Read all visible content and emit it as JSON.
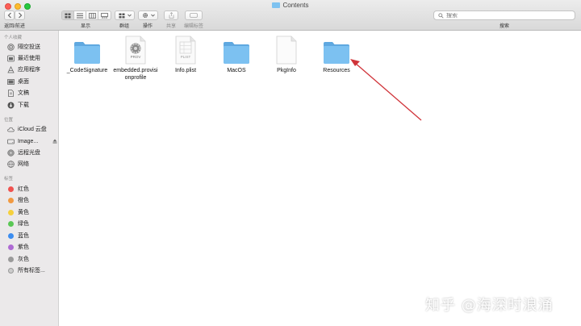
{
  "window": {
    "title": "Contents"
  },
  "toolbar": {
    "back_forward_label": "返回/前进",
    "view_label": "显示",
    "group_label": "群组",
    "action_label": "操作",
    "share_label": "共享",
    "edit_tags_label": "编辑标签",
    "search_placeholder": "搜索",
    "search_label": "搜索"
  },
  "sidebar": {
    "favorites_header": "个人收藏",
    "favorites": [
      {
        "label": "隔空投送",
        "icon": "airdrop-icon"
      },
      {
        "label": "最近使用",
        "icon": "recents-icon"
      },
      {
        "label": "应用程序",
        "icon": "applications-icon"
      },
      {
        "label": "桌面",
        "icon": "desktop-icon"
      },
      {
        "label": "文稿",
        "icon": "documents-icon"
      },
      {
        "label": "下载",
        "icon": "downloads-icon"
      }
    ],
    "locations_header": "位置",
    "locations": [
      {
        "label": "iCloud 云盘",
        "icon": "icloud-icon"
      },
      {
        "label": "Image...",
        "icon": "disk-image-icon"
      },
      {
        "label": "远程光盘",
        "icon": "remote-disc-icon"
      },
      {
        "label": "网络",
        "icon": "network-icon"
      }
    ],
    "tags_header": "标签",
    "tags": [
      {
        "label": "红色",
        "color": "#f0524f"
      },
      {
        "label": "橙色",
        "color": "#f29a42"
      },
      {
        "label": "黄色",
        "color": "#f5d03c"
      },
      {
        "label": "绿色",
        "color": "#5ac755"
      },
      {
        "label": "蓝色",
        "color": "#3c8df0"
      },
      {
        "label": "紫色",
        "color": "#ae6ad3"
      },
      {
        "label": "灰色",
        "color": "#9a9a9a"
      },
      {
        "label": "所有标签...",
        "color": "#cccccc"
      }
    ]
  },
  "files": [
    {
      "name": "_CodeSignature",
      "kind": "folder"
    },
    {
      "name": "embedded.provisionprofile",
      "name_line1": "embedded.provisi",
      "name_line2": "onprofile",
      "kind": "prov",
      "badge": "PROV"
    },
    {
      "name": "Info.plist",
      "kind": "plist",
      "badge": "PLIST"
    },
    {
      "name": "MacOS",
      "kind": "folder"
    },
    {
      "name": "PkgInfo",
      "kind": "document"
    },
    {
      "name": "Resources",
      "kind": "folder"
    }
  ],
  "colors": {
    "folder": "#6db6ec",
    "arrow": "#d0343a",
    "accent": "#3c8df0"
  },
  "watermark": "知乎 @海深时浪涌"
}
